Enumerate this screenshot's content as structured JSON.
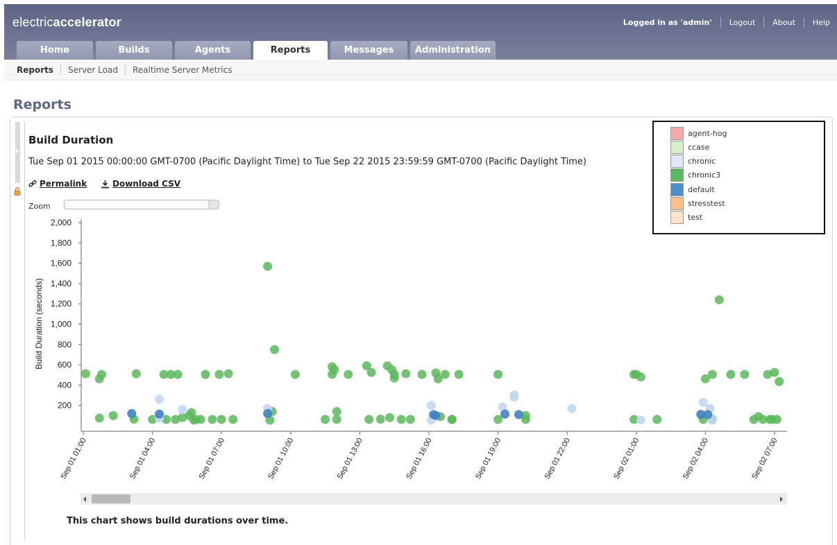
{
  "header": {
    "logo_regular": "electric",
    "logo_bold": "accelerator",
    "logged_in": "Logged in as 'admin'",
    "logout": "Logout",
    "about": "About",
    "help": "Help"
  },
  "tabs": [
    {
      "label": "Home"
    },
    {
      "label": "Builds"
    },
    {
      "label": "Agents"
    },
    {
      "label": "Reports"
    },
    {
      "label": "Messages"
    },
    {
      "label": "Administration"
    }
  ],
  "subnav": {
    "items": [
      {
        "label": "Reports"
      },
      {
        "label": "Server Load"
      },
      {
        "label": "Realtime Server Metrics"
      }
    ]
  },
  "page_title": "Reports",
  "report": {
    "title": "Build Duration",
    "date_range": "Tue Sep 01 2015 00:00:00 GMT-0700 (Pacific Daylight Time) to Tue Sep 22 2015 23:59:59 GMT-0700 (Pacific Daylight Time)",
    "permalink": "Permalink",
    "download": "Download CSV",
    "zoom_label": "Zoom",
    "footnote": "This chart shows build durations over time."
  },
  "colors": {
    "agent-hog": "#f2a9ad",
    "ccase": "#d6f0cd",
    "chronic": "#dfe8f6",
    "chronic3": "#5cb85c",
    "default": "#4e8fc9",
    "stresstest": "#f6c08f",
    "test": "#fce3cc",
    "chronic_point": "#c3d6f2",
    "default_point": "#3f83c2"
  },
  "chart_data": {
    "type": "scatter",
    "ylabel": "Build Duration (seconds)",
    "ylim": [
      0,
      2000
    ],
    "y_ticks": [
      200,
      400,
      600,
      800,
      1000,
      1200,
      1400,
      1600,
      1800,
      2000
    ],
    "y_tick_labels": [
      "200",
      "400",
      "600",
      "800",
      "1,000",
      "1,200",
      "1,400",
      "1,600",
      "1,800",
      "2,000"
    ],
    "x_ticks": [
      1,
      4,
      7,
      10,
      13,
      16,
      19,
      22,
      25,
      28,
      31
    ],
    "x_tick_labels": [
      "Sep 01 01:00",
      "Sep 01 04:00",
      "Sep 01 07:00",
      "Sep 01 10:00",
      "Sep 01 13:00",
      "Sep 01 16:00",
      "Sep 01 19:00",
      "Sep 01 22:00",
      "Sep 02 01:00",
      "Sep 02 04:00",
      "Sep 02 07:00"
    ],
    "xlim_hours": [
      1,
      31.3
    ],
    "legend": [
      "agent-hog",
      "ccase",
      "chronic",
      "chronic3",
      "default",
      "stresstest",
      "test"
    ],
    "legend_position": "top-right",
    "series": [
      {
        "name": "chronic3",
        "x": [
          1.1,
          1.7,
          1.8,
          1.7,
          2.3,
          3.2,
          3.3,
          4.0,
          4.5,
          4.6,
          4.8,
          5.0,
          5.1,
          5.3,
          5.6,
          5.7,
          5.8,
          5.9,
          6.1,
          6.3,
          6.6,
          6.9,
          7.0,
          7.3,
          7.5,
          9.0,
          9.1,
          9.2,
          9.3,
          10.2,
          11.5,
          11.8,
          11.8,
          11.9,
          12.0,
          12.0,
          12.5,
          13.3,
          13.4,
          13.9,
          13.5,
          14.2,
          14.4,
          14.3,
          14.5,
          14.5,
          14.8,
          15.0,
          15.2,
          15.7,
          16.3,
          16.4,
          16.5,
          16.7,
          17.0,
          17.3,
          17.0,
          19.0,
          19.0,
          20.2,
          20.2,
          25.0,
          24.9,
          24.9,
          25.2,
          25.9,
          27.9,
          28.0,
          28.3,
          28.3,
          28.6,
          29.1,
          29.7,
          30.1,
          30.3,
          30.5,
          30.7,
          30.9,
          31.0,
          31.1,
          31.2,
          30.8
        ],
        "y": [
          512,
          75,
          505,
          462,
          100,
          65,
          512,
          62,
          505,
          62,
          505,
          62,
          505,
          80,
          100,
          130,
          55,
          62,
          62,
          505,
          62,
          505,
          62,
          512,
          62,
          1570,
          55,
          140,
          750,
          505,
          62,
          505,
          580,
          550,
          62,
          140,
          505,
          590,
          62,
          65,
          525,
          590,
          550,
          80,
          470,
          505,
          62,
          512,
          62,
          505,
          520,
          462,
          90,
          505,
          62,
          505,
          62,
          505,
          62,
          100,
          62,
          505,
          62,
          505,
          480,
          62,
          62,
          462,
          62,
          505,
          1240,
          505,
          505,
          62,
          90,
          62,
          505,
          62,
          525,
          62,
          435,
          62
        ]
      },
      {
        "name": "chronic",
        "x": [
          4.3,
          4.3,
          5.3,
          9.0,
          16.1,
          16.1,
          19.2,
          19.7,
          19.7,
          22.2,
          25.2,
          27.9,
          28.2,
          28.3
        ],
        "y": [
          260,
          75,
          160,
          170,
          200,
          55,
          185,
          300,
          280,
          170,
          55,
          230,
          170,
          55
        ]
      },
      {
        "name": "default",
        "x": [
          3.1,
          4.3,
          9.0,
          16.2,
          16.3,
          19.3,
          19.9,
          27.8,
          28.1
        ],
        "y": [
          120,
          115,
          120,
          110,
          100,
          115,
          110,
          112,
          110
        ]
      }
    ]
  }
}
